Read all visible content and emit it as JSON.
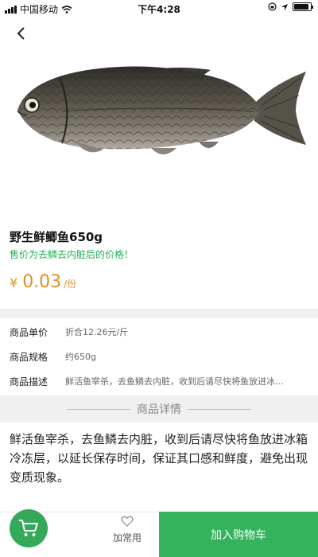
{
  "status_bar": {
    "carrier": "中国移动",
    "time": "下午4:28",
    "battery_level": 0.9
  },
  "header": {
    "back_icon": "chevron-left-icon"
  },
  "product": {
    "image_icon": "fish-image",
    "title": "野生鲜鲫鱼650g",
    "subtitle": "售价为去鳞去内脏后的价格！",
    "price": {
      "currency": "¥",
      "value": "0.03",
      "unit": "/份"
    }
  },
  "attributes": [
    {
      "key": "商品单价",
      "value": "折合12.26元/斤"
    },
    {
      "key": "商品规格",
      "value": "约650g"
    },
    {
      "key": "商品描述",
      "value": "鲜活鱼宰杀，去鱼鳞去内脏，收到后请尽快将鱼放进冰..."
    }
  ],
  "detail": {
    "heading": "商品详情",
    "text": "鲜活鱼宰杀，去鱼鳞去内脏，收到后请尽快将鱼放进冰箱冷冻层，以延长保存时间，保证其口感和鲜度，避免出现变质现象。"
  },
  "bottom_bar": {
    "cart_icon": "cart-icon",
    "favorite_icon": "heart-icon",
    "favorite_label": "加常用",
    "add_to_cart_label": "加入购物车"
  },
  "colors": {
    "accent": "#34b35c",
    "price": "#e28f2d",
    "subtitle": "#26ae5a"
  }
}
